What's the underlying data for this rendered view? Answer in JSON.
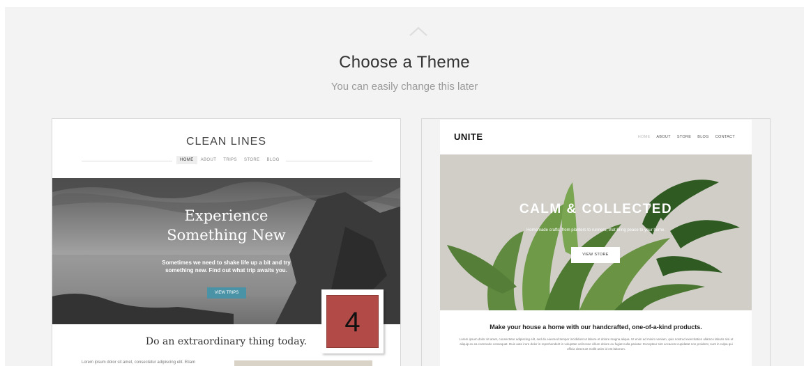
{
  "header": {
    "title": "Choose a Theme",
    "subtitle": "You can easily change this later"
  },
  "themes": [
    {
      "brand": "CLEAN LINES",
      "nav": [
        "HOME",
        "ABOUT",
        "TRIPS",
        "STORE",
        "BLOG"
      ],
      "hero_title_line1": "Experience",
      "hero_title_line2": "Something New",
      "hero_text_line1": "Sometimes we need to shake life up a bit and try",
      "hero_text_line2": "something new. Find out what trip awaits you.",
      "hero_button": "VIEW TRIPS",
      "tagline": "Do an extraordinary thing today.",
      "body_text": "Lorem ipsum dolor sit amet, consectetur adipiscing elit. Etiam"
    },
    {
      "brand": "UNITE",
      "nav": [
        "HOME",
        "ABOUT",
        "STORE",
        "BLOG",
        "CONTACT"
      ],
      "hero_title": "CALM & COLLECTED",
      "hero_text": "Homemade crafts, from planters to runners, that bring peace to your home.",
      "hero_button": "VIEW STORE",
      "tagline": "Make your house a home with our handcrafted, one-of-a-kind products.",
      "body_text": "Lorem ipsum dolor sit amet, consectetur adipiscing elit, sed do eiusmod tempor incididunt ut labore et dolore magna aliqua. Ut enim ad minim veniam, quis nostrud exercitation ullamco laboris nisi ut aliquip ex ea commodo consequat. Duis aute irure dolor in reprehenderit in voluptate velit esse cillum dolore eu fugiat nulla pariatur. Excepteur sint occaecat cupidatat non proident, sunt in culpa qui officia deserunt mollit anim id est laborum."
    }
  ],
  "badge": {
    "label": "4",
    "color": "#b24a47"
  },
  "icons": {
    "collapse": "chevron-up-icon"
  },
  "colors": {
    "background": "#f3f3f3",
    "accent_button": "#4a93a6"
  }
}
